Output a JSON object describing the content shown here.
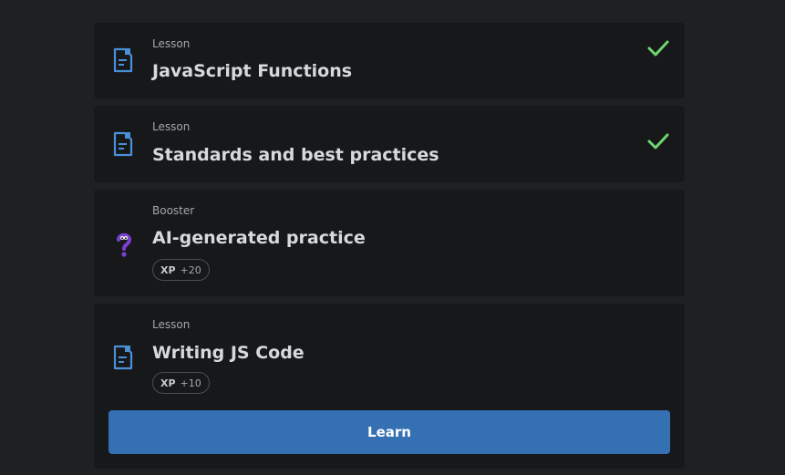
{
  "items": [
    {
      "kind": "Lesson",
      "title": "JavaScript Functions",
      "icon": "lesson-document-icon",
      "completed": true
    },
    {
      "kind": "Lesson",
      "title": "Standards and best practices",
      "icon": "lesson-document-icon",
      "completed": true
    },
    {
      "kind": "Booster",
      "title": "AI-generated practice",
      "icon": "question-mark-mascot-icon",
      "xp_label": "XP",
      "xp_value": "+20"
    },
    {
      "kind": "Lesson",
      "title": "Writing JS Code",
      "icon": "lesson-document-icon",
      "xp_label": "XP",
      "xp_value": "+10",
      "action_label": "Learn"
    }
  ],
  "colors": {
    "background": "#1f2022",
    "card": "#17181a",
    "accent_blue": "#3570b3",
    "lesson_icon": "#4a90d9",
    "check_green": "#6fd66f",
    "booster_purple": "#7b3fd4"
  }
}
